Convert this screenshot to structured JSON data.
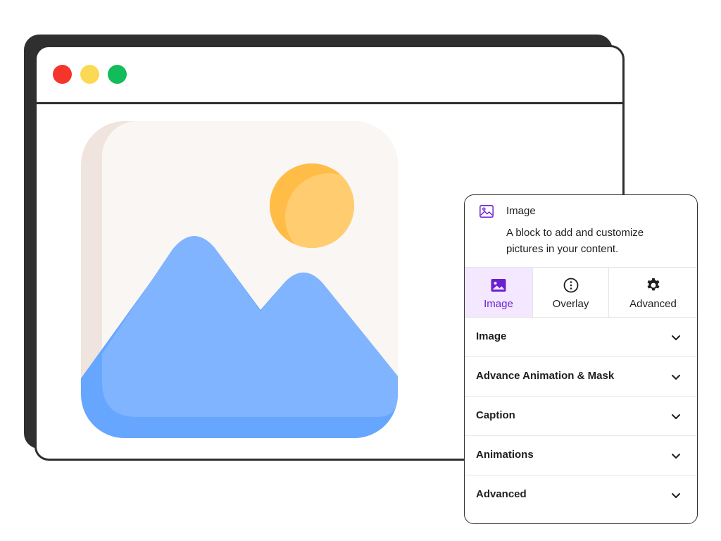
{
  "window": {
    "buttons": [
      "close",
      "minimize",
      "maximize"
    ]
  },
  "illustration": {
    "icon": "image-landscape-icon",
    "colors": {
      "frame_back": "#f0e4df",
      "frame_front": "#faf6f4",
      "sun_dark": "#ffbd47",
      "sun_light": "#ffcd70",
      "mountain": "#80b4ff",
      "mountain_shadow": "#66a6ff"
    }
  },
  "panel": {
    "header": {
      "icon": "image-icon",
      "title": "Image",
      "description": "A block to add and customize pictures in your content."
    },
    "tabs": [
      {
        "label": "Image",
        "icon": "image-icon",
        "active": true
      },
      {
        "label": "Overlay",
        "icon": "info-circle-icon",
        "active": false
      },
      {
        "label": "Advanced",
        "icon": "gear-icon",
        "active": false
      }
    ],
    "sections": [
      {
        "label": "Image"
      },
      {
        "label": "Advance Animation & Mask"
      },
      {
        "label": "Caption"
      },
      {
        "label": "Animations"
      },
      {
        "label": "Advanced"
      }
    ],
    "colors": {
      "accent": "#6b1fd1",
      "active_tab_bg": "#f3e8ff"
    }
  }
}
